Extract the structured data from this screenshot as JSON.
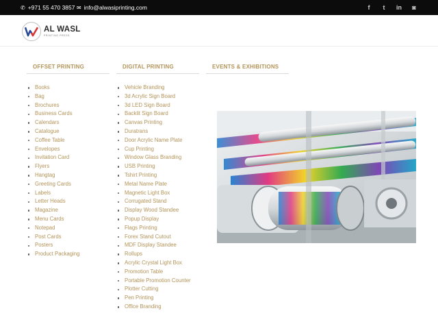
{
  "topbar": {
    "phone": "+971 55 470 3857",
    "email": "info@alwasiprinting.com",
    "phone_icon": "phone-icon",
    "email_icon": "envelope-icon",
    "social": [
      {
        "icon": "facebook-icon",
        "glyph": "f"
      },
      {
        "icon": "twitter-icon",
        "glyph": "t"
      },
      {
        "icon": "linkedin-icon",
        "glyph": "in"
      },
      {
        "icon": "instagram-icon",
        "glyph": "◙"
      }
    ]
  },
  "logo": {
    "brand": "AL WASL",
    "tagline": "PRINTING PRESS"
  },
  "menu": {
    "offset_heading": "OFFSET PRINTING",
    "digital_heading": "DIGITAL PRINTING",
    "events_heading": "EVENTS & EXHIBITIONS",
    "offset_items": [
      "Books",
      "Bag",
      "Brochures",
      "Business Cards",
      "Calendars",
      "Catalogue",
      "Coffee Table",
      "Envelopes",
      "Invitation Card",
      "Flyers",
      "Hangtag",
      "Greeting Cards",
      "Labels",
      "Letter Heads",
      "Magazine",
      "Menu Cards",
      "Notepad",
      "Post Cards",
      "Posters",
      "Product Packaging"
    ],
    "digital_items": [
      "Vehicle Branding",
      "3d Acrylic Sign Board",
      "3d LED Sign Board",
      "Backlit Sign Board",
      "Canvas Printing",
      "Duratrans",
      "Door Acrylic Name Plate",
      "Cup Printing",
      "Window Glass Branding",
      "USB Printing",
      "Tshirt Printing",
      "Metal Name Plate",
      "Magnetic Light Box",
      "Corrugated Stand",
      "Display Wood Standee",
      "Popup Display",
      "Flags Printing",
      "Forex Stand Cutout",
      "MDF Display Standee",
      "Rollups",
      "Acrylic Crystal Light Box",
      "Promotion Table",
      "Portable Promotion Counter",
      "Plotter Cutting",
      "Pen Printing",
      "Office Branding"
    ]
  },
  "colors": {
    "accent": "#b39358",
    "topbar_bg": "#0c0c0c"
  }
}
